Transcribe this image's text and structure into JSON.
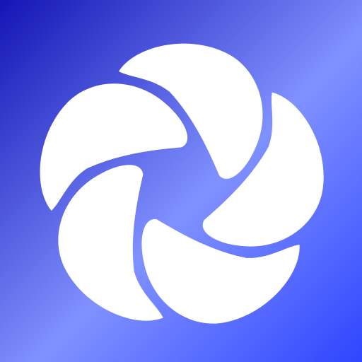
{
  "icon": {
    "name": "pinwheel-logo",
    "colors": {
      "background_top_left": "#1414b4",
      "background_center": "#8091ff",
      "background_bottom_right": "#2e45ff",
      "glyph": "#ffffff"
    }
  }
}
